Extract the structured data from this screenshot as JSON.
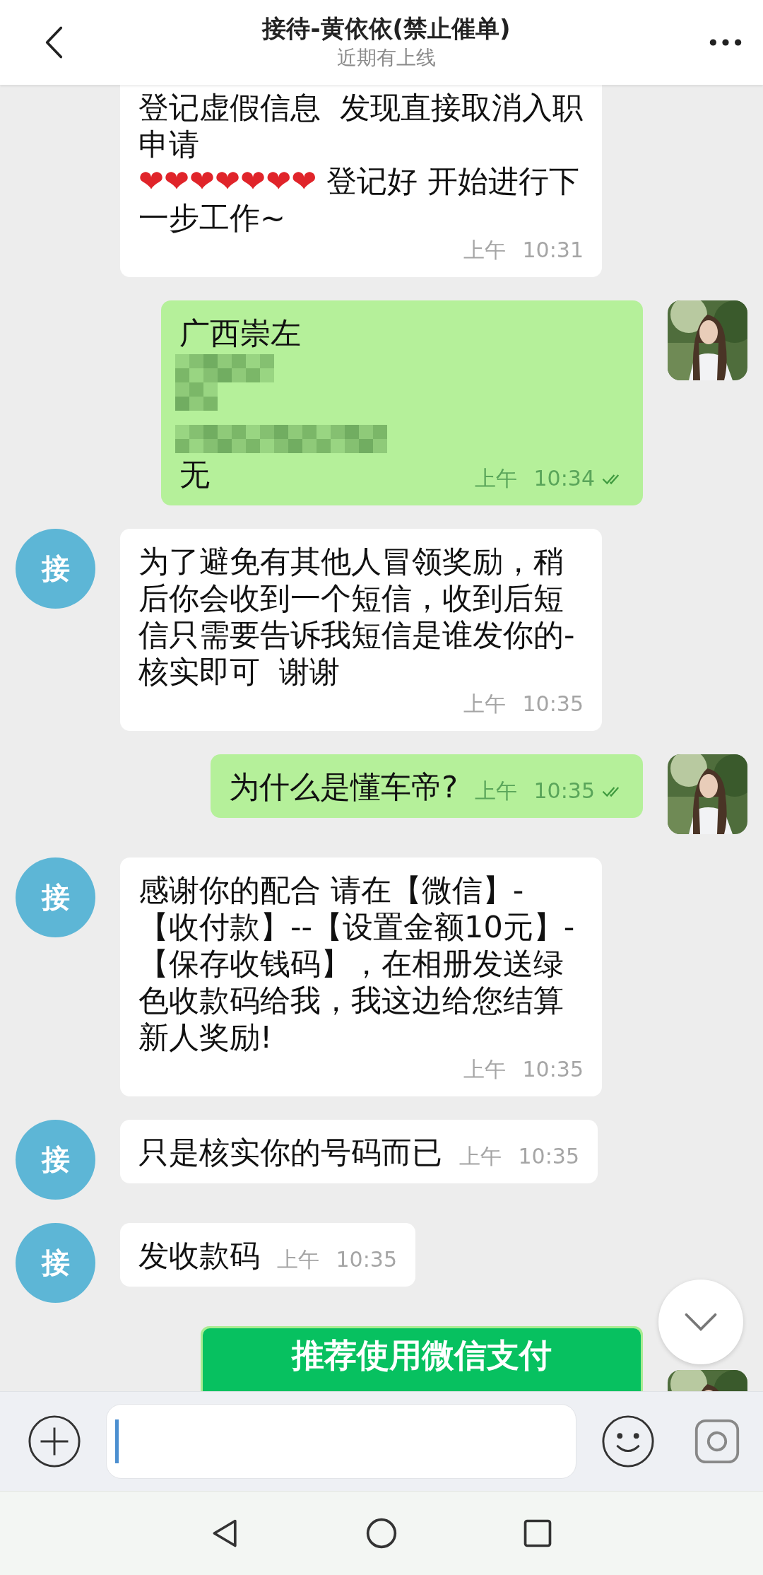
{
  "header": {
    "title": "接待-黄依依(禁止催单)",
    "subtitle": "近期有上线"
  },
  "messages": [
    {
      "kind": "bubble",
      "outgoing": false,
      "blocks": [
        {
          "kind": "text",
          "parts": [
            {
              "kind": "text",
              "text": "登记虚假信息  发现直接取消入职申请"
            },
            {
              "kind": "break"
            },
            {
              "kind": "emoji",
              "text": "❤❤❤❤❤❤❤"
            },
            {
              "kind": "text",
              "text": " 登记好 开始进行下一步工作~"
            }
          ]
        }
      ],
      "time": "上午 10:31"
    },
    {
      "kind": "bubble",
      "outgoing": true,
      "avatar": {
        "kind": "picture"
      },
      "read": true,
      "blocks": [
        {
          "kind": "text",
          "parts": [
            {
              "kind": "text",
              "text": "广西崇左"
            }
          ]
        },
        {
          "kind": "redacted"
        },
        {
          "kind": "text",
          "parts": [
            {
              "kind": "text",
              "text": "无"
            }
          ]
        }
      ],
      "time": "上午 10:34"
    },
    {
      "kind": "bubble",
      "outgoing": false,
      "avatar_text": "接",
      "blocks": [
        {
          "kind": "text",
          "parts": [
            {
              "kind": "text",
              "text": "为了避免有其他人冒领奖励，稍后你会收到一个短信，收到后短信只需要告诉我短信是谁发你的-核实即可  谢谢"
            }
          ]
        }
      ],
      "time": "上午 10:35"
    },
    {
      "kind": "bubble",
      "outgoing": true,
      "avatar": {
        "kind": "picture"
      },
      "read": true,
      "blocks": [
        {
          "kind": "text",
          "parts": [
            {
              "kind": "text",
              "text": "为什么是懂车帝?"
            }
          ]
        }
      ],
      "time": "上午 10:35"
    },
    {
      "kind": "bubble",
      "outgoing": false,
      "avatar_text": "接",
      "blocks": [
        {
          "kind": "text",
          "parts": [
            {
              "kind": "text",
              "text": "感谢你的配合 请在【微信】-【收付款】--【设置金额10元】-【保存收钱码】，在相册发送绿色收款码给我，我这边给您结算新人奖励!"
            }
          ]
        }
      ],
      "time": "上午 10:35"
    },
    {
      "kind": "bubble",
      "outgoing": false,
      "avatar_text": "接",
      "blocks": [
        {
          "kind": "text",
          "parts": [
            {
              "kind": "text",
              "text": "只是核实你的号码而已"
            }
          ]
        }
      ],
      "time": "上午 10:35"
    },
    {
      "kind": "bubble",
      "outgoing": false,
      "avatar_text": "接",
      "blocks": [
        {
          "kind": "text",
          "parts": [
            {
              "kind": "text",
              "text": "发收款码"
            }
          ]
        }
      ],
      "time": "上午 10:35"
    },
    {
      "kind": "card",
      "outgoing": true,
      "avatar": {
        "kind": "picture"
      },
      "card_text": "推荐使用微信支付"
    }
  ]
}
